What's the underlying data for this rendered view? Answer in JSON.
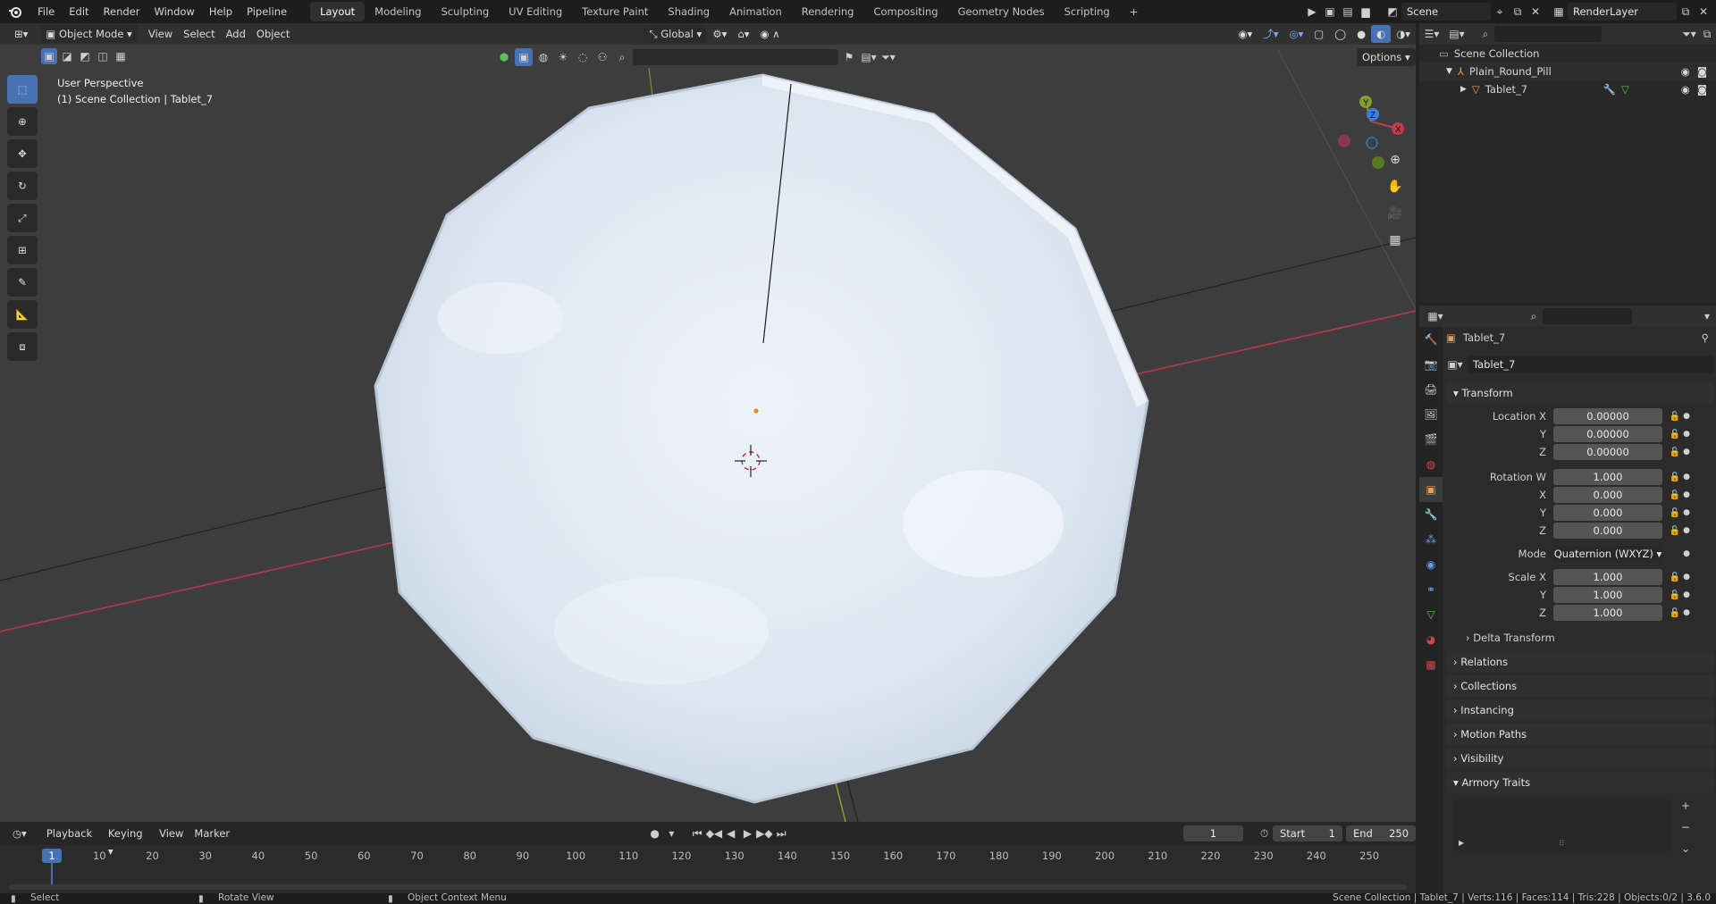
{
  "topbar": {
    "menus": [
      "File",
      "Edit",
      "Render",
      "Window",
      "Help",
      "Pipeline"
    ],
    "workspaces": [
      "Layout",
      "Modeling",
      "Sculpting",
      "UV Editing",
      "Texture Paint",
      "Shading",
      "Animation",
      "Rendering",
      "Compositing",
      "Geometry Nodes",
      "Scripting"
    ],
    "active_workspace": "Layout",
    "add_workspace": "+",
    "scene_name": "Scene",
    "view_layer": "RenderLayer"
  },
  "viewport_header": {
    "mode": "Object Mode",
    "menus": [
      "View",
      "Select",
      "Add",
      "Object"
    ],
    "orientation": "Global",
    "options_label": "Options"
  },
  "viewport": {
    "view_name": "User Perspective",
    "collection_info": "(1) Scene Collection | Tablet_7"
  },
  "outliner": {
    "root": "Scene Collection",
    "items": [
      {
        "label": "Plain_Round_Pill",
        "type": "armature"
      },
      {
        "label": "Tablet_7",
        "type": "mesh"
      }
    ]
  },
  "properties": {
    "object_name": "Tablet_7",
    "data_name": "Tablet_7",
    "transform_label": "Transform",
    "rows": [
      {
        "label": "Location X",
        "value": "0.00000"
      },
      {
        "label": "Y",
        "value": "0.00000"
      },
      {
        "label": "Z",
        "value": "0.00000"
      },
      {
        "label": "Rotation W",
        "value": "1.000"
      },
      {
        "label": "X",
        "value": "0.000"
      },
      {
        "label": "Y",
        "value": "0.000"
      },
      {
        "label": "Z",
        "value": "0.000"
      },
      {
        "label": "Mode",
        "value": "Quaternion (WXYZ)"
      },
      {
        "label": "Scale X",
        "value": "1.000"
      },
      {
        "label": "Y",
        "value": "1.000"
      },
      {
        "label": "Z",
        "value": "1.000"
      }
    ],
    "delta_transform": "Delta Transform",
    "panels": [
      "Relations",
      "Collections",
      "Instancing",
      "Motion Paths",
      "Visibility",
      "Armory Traits"
    ]
  },
  "timeline": {
    "menus": [
      "Playback",
      "Keying",
      "View",
      "Marker"
    ],
    "current_frame": "1",
    "start_label": "Start",
    "start": "1",
    "end_label": "End",
    "end": "250",
    "ticks": [
      "1",
      "10",
      "20",
      "30",
      "40",
      "50",
      "60",
      "70",
      "80",
      "90",
      "100",
      "110",
      "120",
      "130",
      "140",
      "150",
      "160",
      "170",
      "180",
      "190",
      "200",
      "210",
      "220",
      "230",
      "240",
      "250"
    ]
  },
  "statusbar": {
    "select": "Select",
    "rotate": "Rotate View",
    "context": "Object Context Menu",
    "stats": "Scene Collection | Tablet_7 | Verts:116 | Faces:114 | Tris:228 | Objects:0/2 | 3.6.0"
  },
  "colors": {
    "accent": "#4772b3",
    "x_axis": "#c43c4a",
    "y_axis": "#7fa02a",
    "tablet": "#dfe8f3"
  }
}
